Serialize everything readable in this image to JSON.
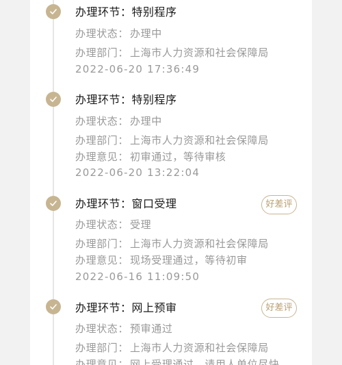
{
  "labels": {
    "step": "办理环节：",
    "status": "办理状态：",
    "department": "办理部门：",
    "opinion": "办理意见："
  },
  "steps": [
    {
      "name": "特别程序",
      "status": "办理中",
      "department": "上海市人力资源和社会保障局",
      "timestamp": "2022-06-20 17:36:49"
    },
    {
      "name": "特别程序",
      "status": "办理中",
      "department": "上海市人力资源和社会保障局",
      "opinion": "初审通过，等待审核",
      "timestamp": "2022-06-20 13:22:04"
    },
    {
      "name": "窗口受理",
      "status": "受理",
      "department": "上海市人力资源和社会保障局",
      "opinion": "现场受理通过，等待初审",
      "timestamp": "2022-06-16 11:09:50",
      "rating_button": "好差评"
    },
    {
      "name": "网上预审",
      "status": "预审通过",
      "department": "上海市人力资源和社会保障局",
      "opinion": "网上受理通过，请用人单位尽快",
      "rating_button": "好差评"
    }
  ],
  "icons": {
    "step_marker": "check-circle-icon"
  },
  "colors": {
    "accent": "#c7b592",
    "accent_text": "#b79f72",
    "title_text": "#1a1a1a",
    "secondary_text": "#999999",
    "background": "#f2f2f2",
    "card": "#ffffff"
  }
}
